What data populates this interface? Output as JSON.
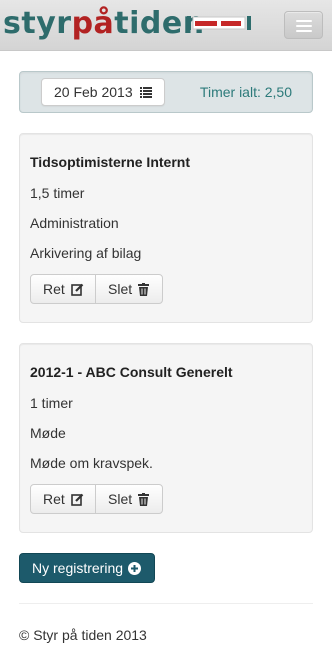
{
  "brand": {
    "part1": "styr",
    "part2": "på",
    "part3": "tiden"
  },
  "nav": {
    "toggle_icon": "hamburger-icon"
  },
  "summary": {
    "date": "20 Feb 2013",
    "date_icon": "list-icon",
    "total": "Timer ialt: 2,50"
  },
  "entries": [
    {
      "project": "Tidsoptimisterne Internt",
      "hours": "1,5 timer",
      "activity": "Administration",
      "description": "Arkivering af bilag",
      "edit_label": "Ret",
      "delete_label": "Slet"
    },
    {
      "project": "2012-1 - ABC Consult Generelt",
      "hours": "1 timer",
      "activity": "Møde",
      "description": "Møde om kravspek.",
      "edit_label": "Ret",
      "delete_label": "Slet"
    }
  ],
  "actions": {
    "new_label": "Ny registrering",
    "new_icon": "plus-circle-icon"
  },
  "footer": {
    "copyright": "© Styr på tiden 2013"
  },
  "colors": {
    "brand_teal": "#2e6c6c",
    "brand_red": "#b22222",
    "primary_button": "#1d5a6b",
    "total_text": "#2c7a7a"
  }
}
